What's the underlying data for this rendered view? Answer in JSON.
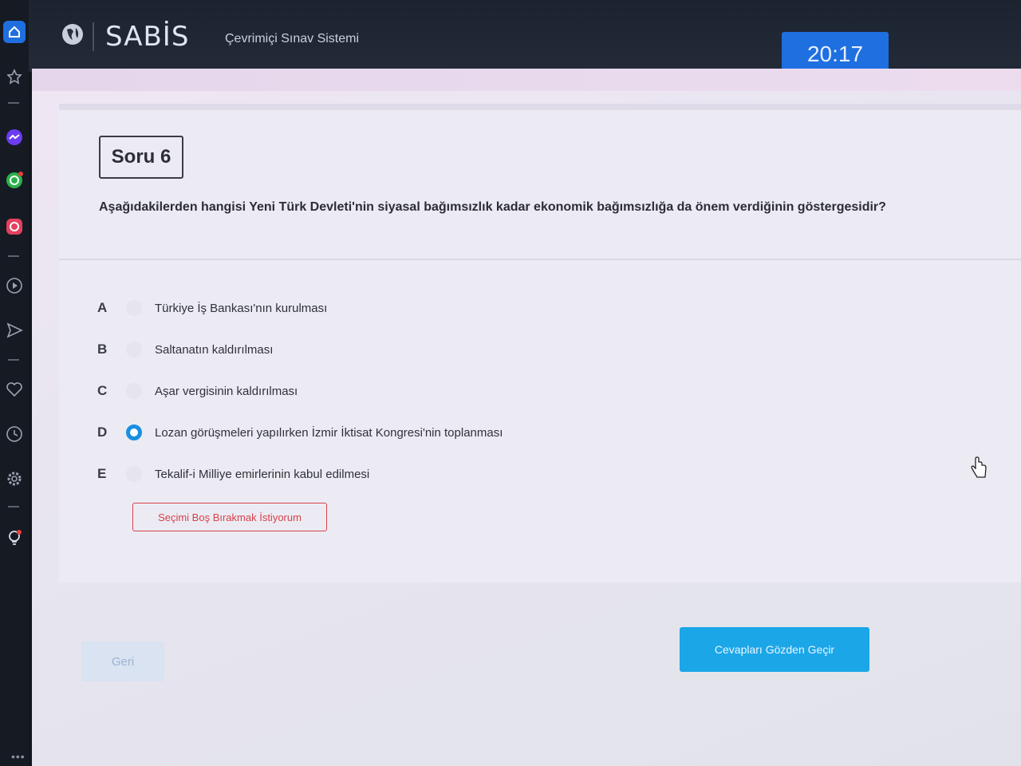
{
  "header": {
    "brand": "SABİS",
    "subtitle": "Çevrimiçi Sınav Sistemi",
    "timer": "20:17"
  },
  "question": {
    "number_label": "Soru 6",
    "text": "Aşağıdakilerden hangisi Yeni Türk Devleti'nin siyasal bağımsızlık kadar ekonomik bağımsızlığa da önem verdiğinin göstergesidir?",
    "options": [
      {
        "letter": "A",
        "text": "Türkiye İş Bankası'nın kurulması",
        "selected": false
      },
      {
        "letter": "B",
        "text": "Saltanatın kaldırılması",
        "selected": false
      },
      {
        "letter": "C",
        "text": "Aşar vergisinin kaldırılması",
        "selected": false
      },
      {
        "letter": "D",
        "text": "Lozan görüşmeleri yapılırken İzmir İktisat Kongresi'nin toplanması",
        "selected": true
      },
      {
        "letter": "E",
        "text": "Tekalif-i Milliye emirlerinin kabul edilmesi",
        "selected": false
      }
    ],
    "leave_blank_label": "Seçimi Boş Bırakmak İstiyorum"
  },
  "footer": {
    "back_label": "Geri",
    "review_label": "Cevapları Gözden Geçir"
  },
  "colors": {
    "timer_bg": "#1e6fe0",
    "selected_radio": "#1a8fe0",
    "leave_blank": "#d8414a",
    "review_button": "#1ba6e8"
  },
  "sidebar_icons": [
    "home-icon",
    "star-icon",
    "messenger-icon",
    "whatsapp-icon",
    "instagram-icon",
    "play-icon",
    "send-icon",
    "heart-icon",
    "clock-icon",
    "settings-icon",
    "lightbulb-icon"
  ]
}
